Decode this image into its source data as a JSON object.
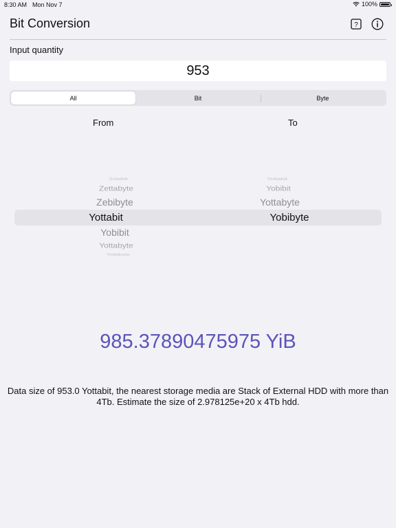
{
  "status_bar": {
    "time": "8:30 AM",
    "date": "Mon Nov 7",
    "battery": "100%"
  },
  "header": {
    "title": "Bit Conversion",
    "help_icon": "question-square-icon",
    "info_icon": "info-circle-icon"
  },
  "input": {
    "label": "Input quantity",
    "value": "953"
  },
  "segments": {
    "items": [
      "All",
      "Bit",
      "Byte"
    ],
    "selected": "All"
  },
  "columns": {
    "from_label": "From",
    "to_label": "To"
  },
  "from_picker": {
    "items": [
      "Zebibit",
      "Zettabyte",
      "Zebibyte",
      "Yottabit",
      "Yobibit",
      "Yottabyte",
      "Yobibyte"
    ],
    "selected": "Yottabit"
  },
  "to_picker": {
    "items": [
      "Yottabit",
      "Yobibit",
      "Yottabyte",
      "Yobibyte"
    ],
    "selected": "Yobibyte"
  },
  "result": "985.37890475975 YiB",
  "description": "Data size of 953.0 Yottabit, the nearest storage media are Stack of External HDD with more than 4Tb. Estimate the size of 2.978125e+20 x 4Tb hdd.",
  "colors": {
    "accent": "#5b54b8",
    "background": "#f2f1f6"
  }
}
